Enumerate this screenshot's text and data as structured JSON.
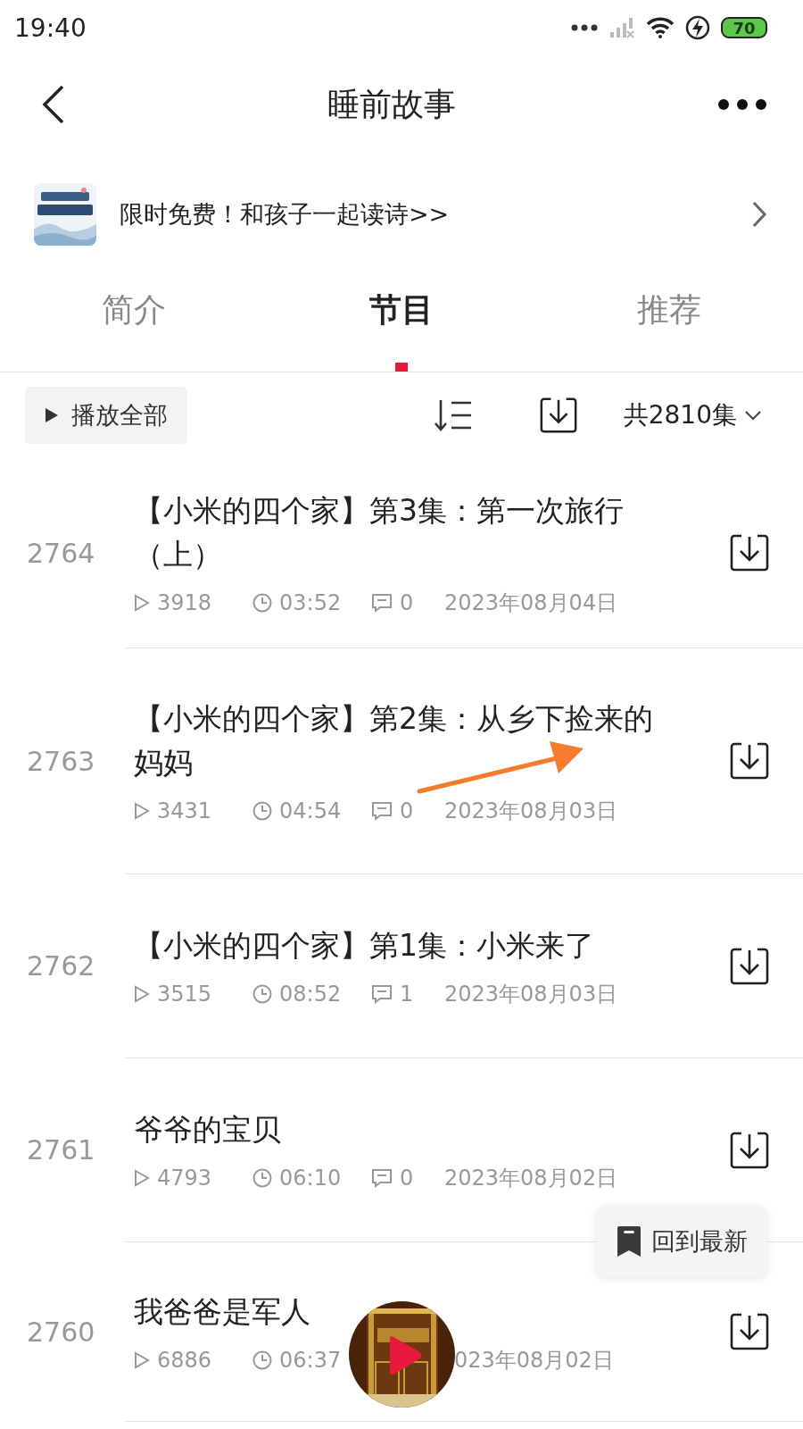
{
  "status_bar": {
    "time": "19:40",
    "battery": "70"
  },
  "header": {
    "title": "睡前故事"
  },
  "promo": {
    "text": "限时免费！和孩子一起读诗>>"
  },
  "tabs": [
    {
      "label": "简介",
      "selected": false
    },
    {
      "label": "节目",
      "selected": true
    },
    {
      "label": "推荐",
      "selected": false
    }
  ],
  "toolbar": {
    "play_all": "播放全部",
    "count": "共2810集"
  },
  "episodes": [
    {
      "number": "2764",
      "title": "【小米的四个家】第3集：第一次旅行（上）",
      "plays": "3918",
      "duration": "03:52",
      "comments": "0",
      "date": "2023年08月04日"
    },
    {
      "number": "2763",
      "title": "【小米的四个家】第2集：从乡下捡来的妈妈",
      "plays": "3431",
      "duration": "04:54",
      "comments": "0",
      "date": "2023年08月03日"
    },
    {
      "number": "2762",
      "title": "【小米的四个家】第1集：小米来了",
      "plays": "3515",
      "duration": "08:52",
      "comments": "1",
      "date": "2023年08月03日"
    },
    {
      "number": "2761",
      "title": "爷爷的宝贝",
      "plays": "4793",
      "duration": "06:10",
      "comments": "0",
      "date": "2023年08月02日"
    },
    {
      "number": "2760",
      "title": "我爸爸是军人",
      "plays": "6886",
      "duration": "06:37",
      "date": "023年08月02日"
    }
  ],
  "back_to_latest": {
    "label": "回到最新"
  }
}
